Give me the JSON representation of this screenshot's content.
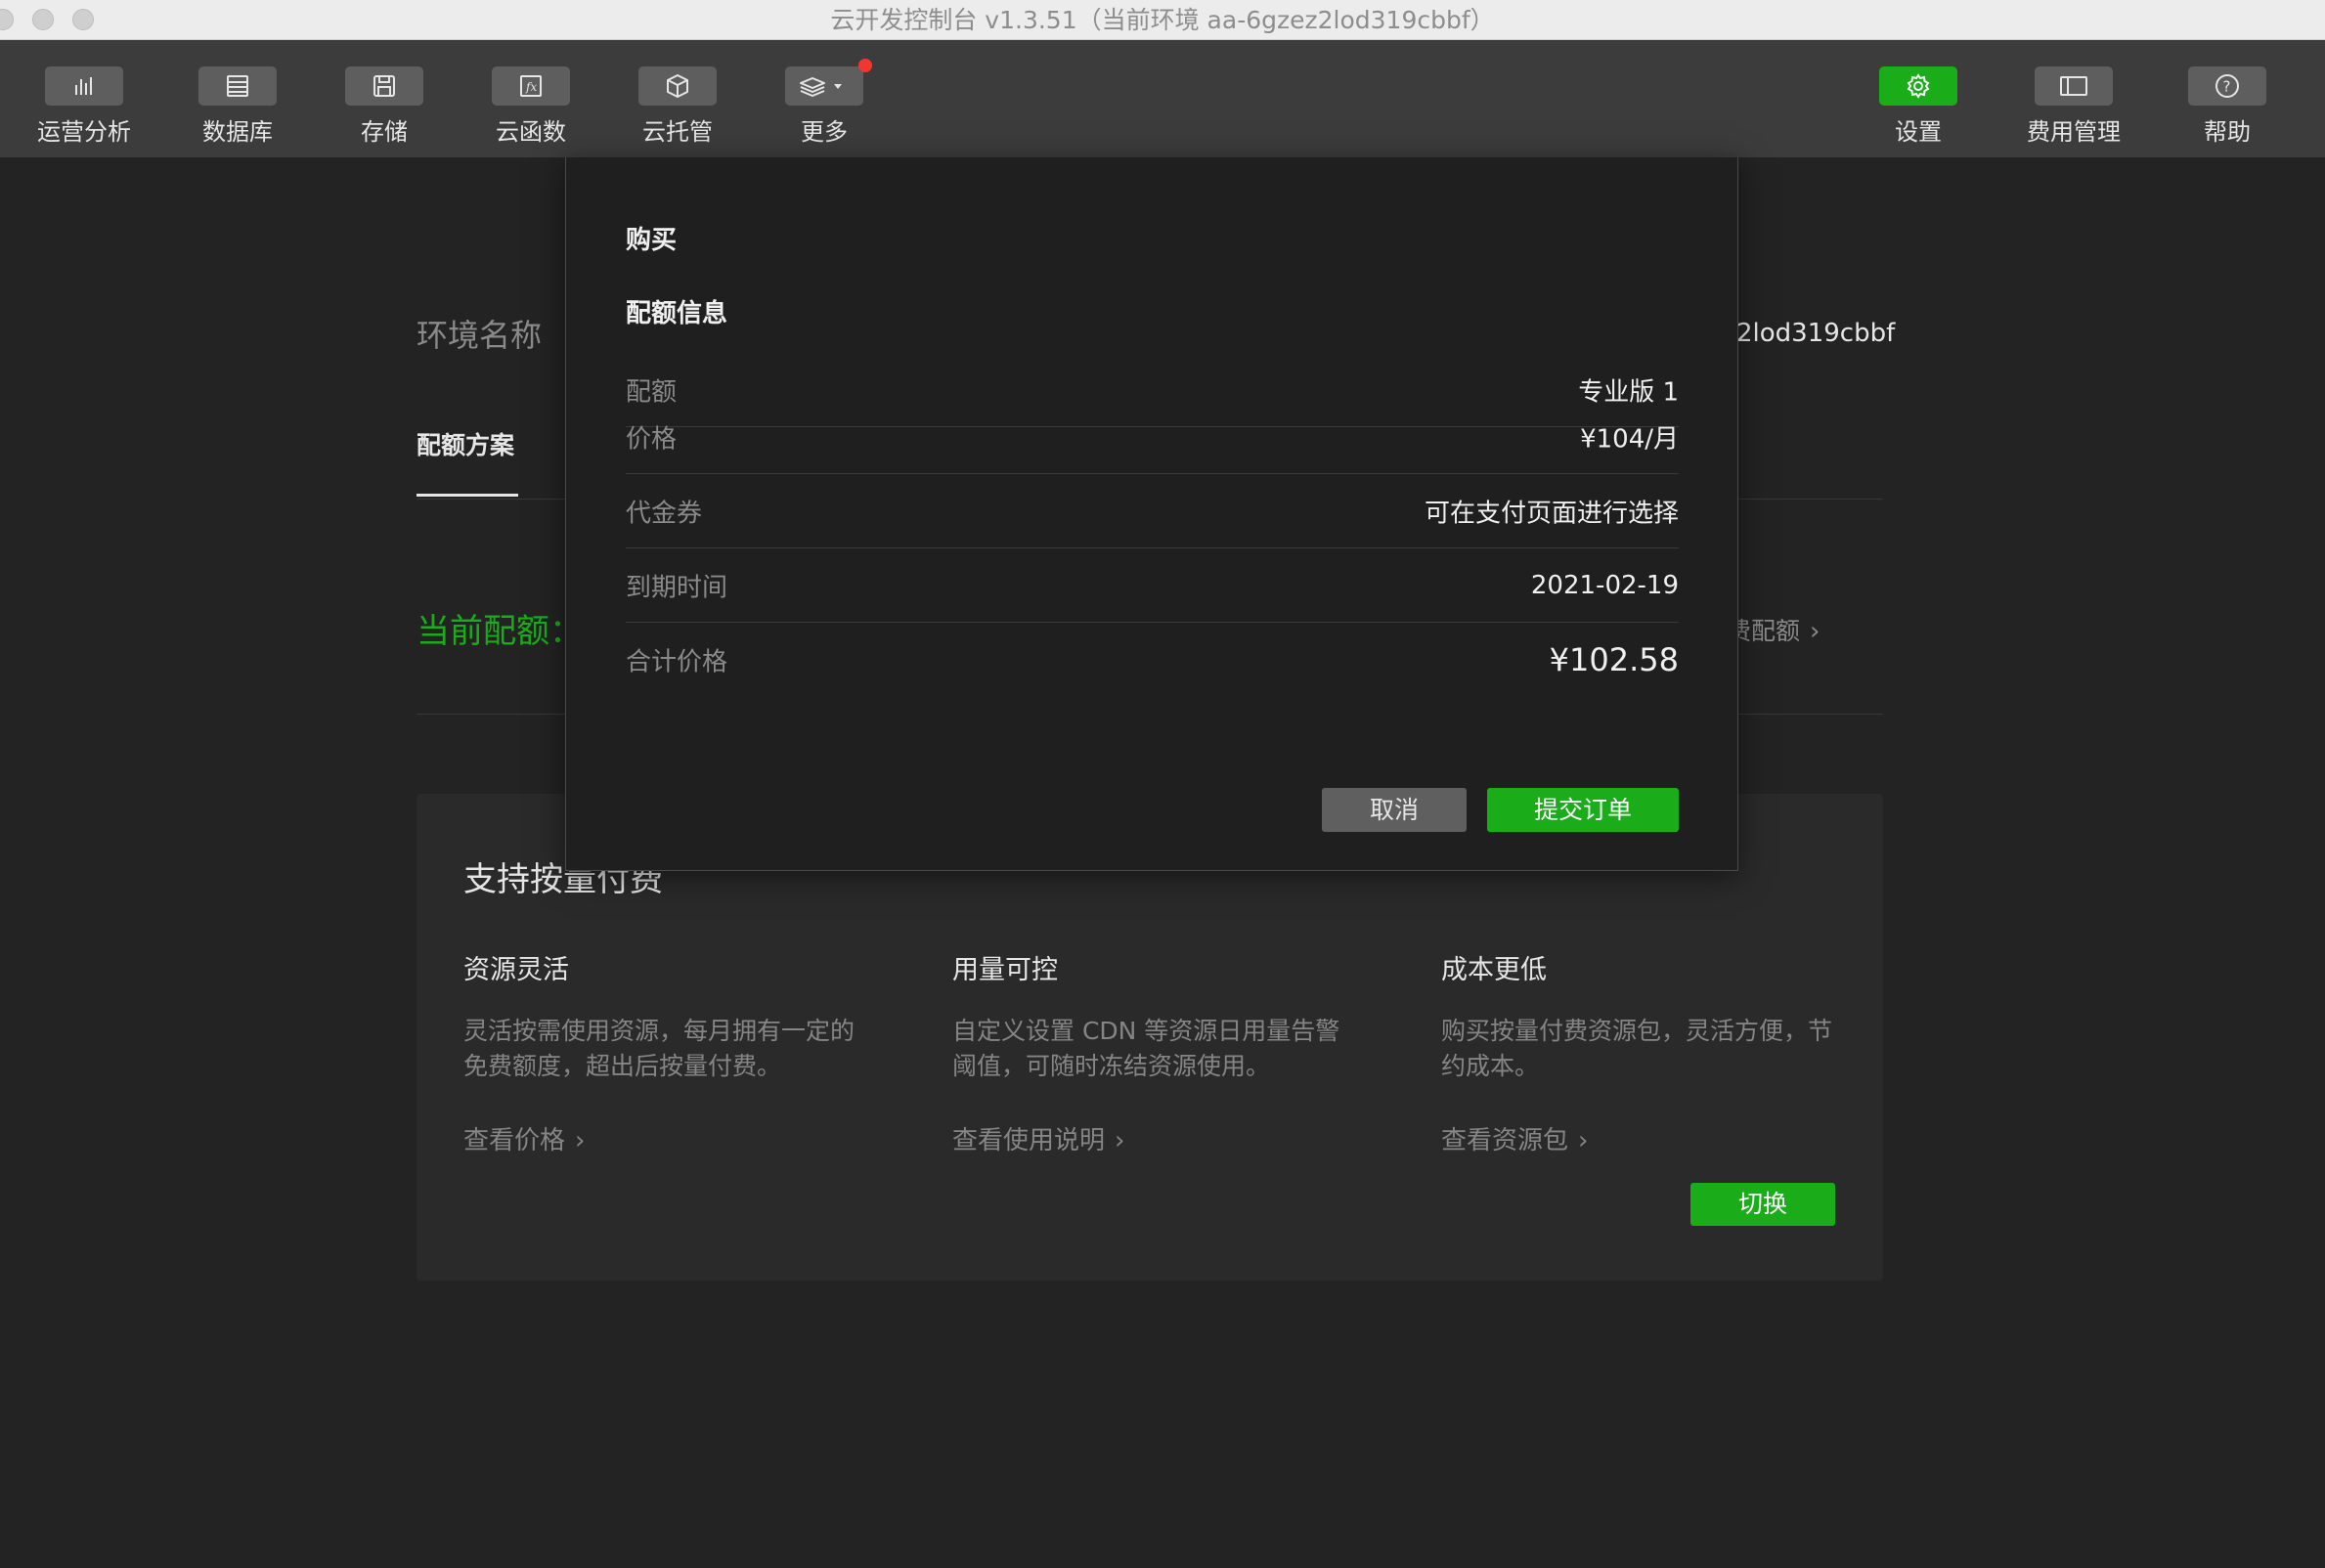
{
  "window": {
    "title": "云开发控制台 v1.3.51（当前环境 aa-6gzez2lod319cbbf）"
  },
  "toolbar": {
    "left_items": [
      {
        "label": "运营分析",
        "icon": "bar-chart-icon"
      },
      {
        "label": "数据库",
        "icon": "database-icon"
      },
      {
        "label": "存储",
        "icon": "save-icon"
      },
      {
        "label": "云函数",
        "icon": "function-icon"
      },
      {
        "label": "云托管",
        "icon": "cube-icon"
      },
      {
        "label": "更多",
        "icon": "layers-icon",
        "has_notification_dot": true
      }
    ],
    "right_items": [
      {
        "label": "设置",
        "icon": "gear-icon",
        "active": true
      },
      {
        "label": "费用管理",
        "icon": "billing-icon"
      },
      {
        "label": "帮助",
        "icon": "help-icon"
      }
    ]
  },
  "page": {
    "env_label": "环境名称",
    "env_value": "2lod319cbbf",
    "tab_label": "配额方案",
    "current_quota_label": "当前配额：",
    "switch_link": "费配额",
    "pay_card": {
      "title": "支持按量付费",
      "features": [
        {
          "title": "资源灵活",
          "desc": "灵活按需使用资源，每月拥有一定的免费额度，超出后按量付费。",
          "link": "查看价格"
        },
        {
          "title": "用量可控",
          "desc": "自定义设置 CDN 等资源日用量告警阈值，可随时冻结资源使用。",
          "link": "查看使用说明"
        },
        {
          "title": "成本更低",
          "desc": "购买按量付费资源包，灵活方便，节约成本。",
          "link": "查看资源包"
        }
      ],
      "switch_button": "切换"
    }
  },
  "modal": {
    "title": "购买",
    "section_title": "配额信息",
    "rows": [
      {
        "label": "配额",
        "value": "专业版 1"
      },
      {
        "label": "价格",
        "value": "¥104/月"
      },
      {
        "label": "代金券",
        "value": "可在支付页面进行选择"
      },
      {
        "label": "到期时间",
        "value": "2021-02-19"
      },
      {
        "label": "合计价格",
        "value": "¥102.58"
      }
    ],
    "cancel_button": "取消",
    "submit_button": "提交订单"
  },
  "colors": {
    "accent": "#1aad19",
    "background": "#232323",
    "toolbar": "#3c3c3c",
    "notification": "#f43530"
  }
}
